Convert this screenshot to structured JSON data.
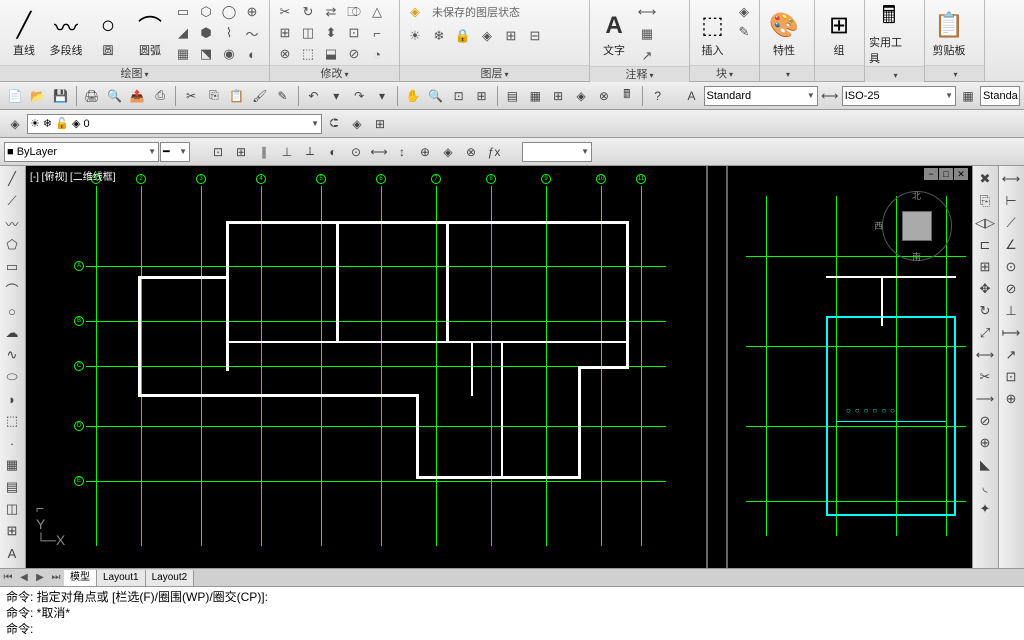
{
  "ribbon": {
    "draw": {
      "title": "绘图",
      "line": "直线",
      "polyline": "多段线",
      "circle": "圆",
      "arc": "圆弧"
    },
    "modify": {
      "title": "修改"
    },
    "layers": {
      "title": "图层",
      "unsaved": "未保存的图层状态"
    },
    "annotate": {
      "title": "注释",
      "text": "文字"
    },
    "block": {
      "title": "块",
      "insert": "插入"
    },
    "props": {
      "title": "特性"
    },
    "group": {
      "title": "组"
    },
    "utils": {
      "title": "实用工具"
    },
    "clipboard": {
      "title": "剪贴板"
    }
  },
  "toolbar": {
    "textStyle": "Standard",
    "dimStyle": "ISO-25",
    "tableStyle": "Standa"
  },
  "layer": {
    "current": "0",
    "bylayer": "ByLayer"
  },
  "viewport": {
    "label": "[-] [俯视] [二维线框]"
  },
  "viewcube": {
    "n": "北",
    "s": "南",
    "w": "西"
  },
  "tabs": {
    "model": "模型",
    "layout1": "Layout1",
    "layout2": "Layout2"
  },
  "command": {
    "line1": "命令:  指定对角点或 [栏选(F)/圈围(WP)/圈交(CP)]:",
    "line2": "命令:  *取消*",
    "line3": "命令:"
  }
}
